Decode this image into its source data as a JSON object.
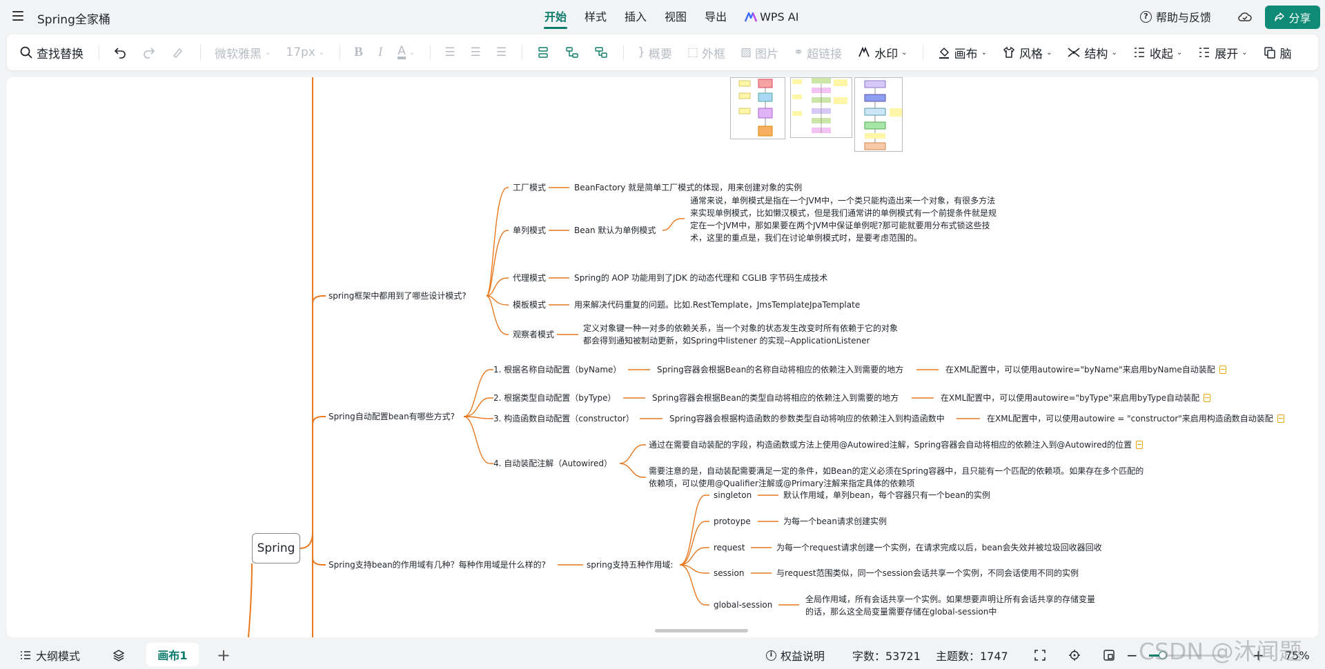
{
  "app": {
    "title": "Spring全家桶",
    "tabs": [
      "开始",
      "样式",
      "插入",
      "视图",
      "导出",
      "WPS AI"
    ],
    "help": "帮助与反馈",
    "share": "分享"
  },
  "toolbar": {
    "find_replace": "查找替换",
    "font": "微软雅黑",
    "font_size": "17px",
    "summary": "概要",
    "frame": "外框",
    "image": "图片",
    "hyperlink": "超链接",
    "watermark": "水印",
    "canvas": "画布",
    "style": "风格",
    "structure": "结构",
    "collapse": "收起",
    "expand": "展开",
    "last": "脑"
  },
  "mindmap": {
    "root": "Spring",
    "design_patterns": {
      "question": "spring框架中都用到了哪些设计模式?",
      "items": [
        {
          "name": "工厂模式",
          "desc": "BeanFactory 就是简单工厂模式的体现，用来创建对象的实例"
        },
        {
          "name": "单列模式",
          "desc": "Bean 默认为单例模式",
          "extra": "通常来说，单例模式是指在一个JVM中，一个类只能构造出来一个对象，有很多方法来实现单例模式，比如懒汉模式，但是我们通常讲的单例模式有一个前提条件就是规定在一个JVM中，那如果要在两个JVM中保证单例呢?那可能就要用分布式锁这些技术，这里的重点是，我们在讨论单例模式时，是要考虑范围的。"
        },
        {
          "name": "代理模式",
          "desc": "Spring的 AOP 功能用到了JDK 的动态代理和 CGLIB 字节码生成技术"
        },
        {
          "name": "模板模式",
          "desc": "用来解决代码重复的问题。比如.RestTemplate，JmsTemplateJpaTemplate"
        },
        {
          "name": "观察者模式",
          "desc": "定义对象键一种一对多的依赖关系，当一个对象的状态发生改变时所有依赖于它的对象都会得到通知被制动更新，如Spring中listener 的实现--ApplicationListener"
        }
      ]
    },
    "autowire": {
      "question": "Spring自动配置bean有哪些方式?",
      "items": [
        {
          "name": "1. 根据名称自动配置（byName）",
          "desc": "Spring容器会根据Bean的名称自动将相应的依赖注入到需要的地方",
          "xml": "在XML配置中，可以使用autowire=\"byName\"来启用byName自动装配"
        },
        {
          "name": "2. 根据类型自动配置（byType）",
          "desc": "Spring容器会根据Bean的类型自动将相应的依赖注入到需要的地方",
          "xml": "在XML配置中，可以使用autowire=\"byType\"来启用byType自动装配"
        },
        {
          "name": "3. 构造函数自动配置（constructor）",
          "desc": "Spring容器会根据构造函数的参数类型自动将响应的依赖注入到构造函数中",
          "xml": "在XML配置中，可以使用autowire = \"constructor\"来启用构造函数自动装配"
        },
        {
          "name": "4. 自动装配注解（Autowired）",
          "desc1": "通过在需要自动装配的字段，构造函数或方法上使用@Autowired注解，Spring容器会自动将相应的依赖注入到@Autowired的位置",
          "desc2": "需要注意的是，自动装配需要满足一定的条件，如Bean的定义必须在Spring容器中，且只能有一个匹配的依赖项。如果存在多个匹配的依赖项，可以使用@Qualifier注解或@Primary注解来指定具体的依赖项"
        }
      ]
    },
    "scope": {
      "question": "Spring支持bean的作用域有几种？每种作用域是什么样的?",
      "middle": "spring支持五种作用域:",
      "items": [
        {
          "name": "singleton",
          "desc": "默认作用域，单列bean，每个容器只有一个bean的实例"
        },
        {
          "name": "protoype",
          "desc": "为每一个bean请求创建实例"
        },
        {
          "name": "request",
          "desc": "为每一个request请求创建一个实例，在请求完成以后，bean会失效并被垃圾回收器回收"
        },
        {
          "name": "session",
          "desc": "与request范围类似，同一个session会话共享一个实例，不同会话使用不同的实例"
        },
        {
          "name": "global-session",
          "desc": "全局作用域，所有会话共享一个实例。如果想要声明让所有会话共享的存储变量的话，那么这全局变量需要存储在global-session中"
        }
      ]
    }
  },
  "bottom": {
    "outline": "大纲模式",
    "sheet": "画布1",
    "rights": "权益说明",
    "word_count": "字数：53721",
    "topic_count": "主题数：1747",
    "zoom": "75%"
  },
  "watermark_text": "CSDN @沐闻题",
  "colors": {
    "accent": "#0a7a6a",
    "branch": "#e8771e",
    "share_bg": "#0f8a76"
  }
}
